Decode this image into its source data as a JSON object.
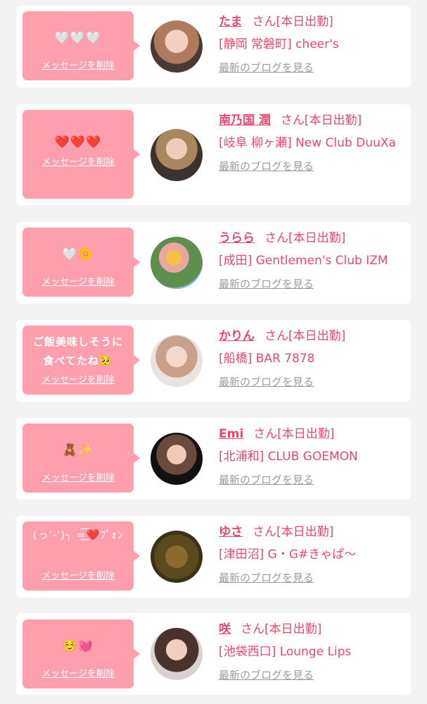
{
  "common": {
    "delete_label": "メッセージを削除",
    "blog_label": "最新のブログを見る",
    "san": "さん",
    "status": "[本日出勤]"
  },
  "colors": {
    "bubble": "#ff9fae",
    "accent": "#e8476d",
    "muted": "#9b9b9b",
    "background": "#f3f3f4"
  },
  "messages": [
    {
      "message": "🤍🤍🤍",
      "name": "たま",
      "shop": "[静岡 常磐町] cheer's"
    },
    {
      "message": "❤️❤️❤️",
      "name": "南乃国 潤",
      "shop": "[岐阜 柳ヶ瀬] New Club DuuXa"
    },
    {
      "message": "🤍🌼",
      "name": "うらら",
      "shop": "[成田] Gentlemen's Club IZM"
    },
    {
      "message": "ご飯美味しそうに食べてたね🥺",
      "name": "かりん",
      "shop": "[船橋] BAR 7878"
    },
    {
      "message": "🧸✨",
      "name": "Emi",
      "shop": "[北浦和] CLUB GOEMON"
    },
    {
      "message": "(っ'-')╮ =͟͟͞͞❤️ﾌﾞｫﾝ",
      "name": "ゆさ",
      "shop": "[津田沼] G・G#きゃぱ〜"
    },
    {
      "message": "☺️💓",
      "name": "咲",
      "shop": "[池袋西口] Lounge Lips"
    }
  ]
}
